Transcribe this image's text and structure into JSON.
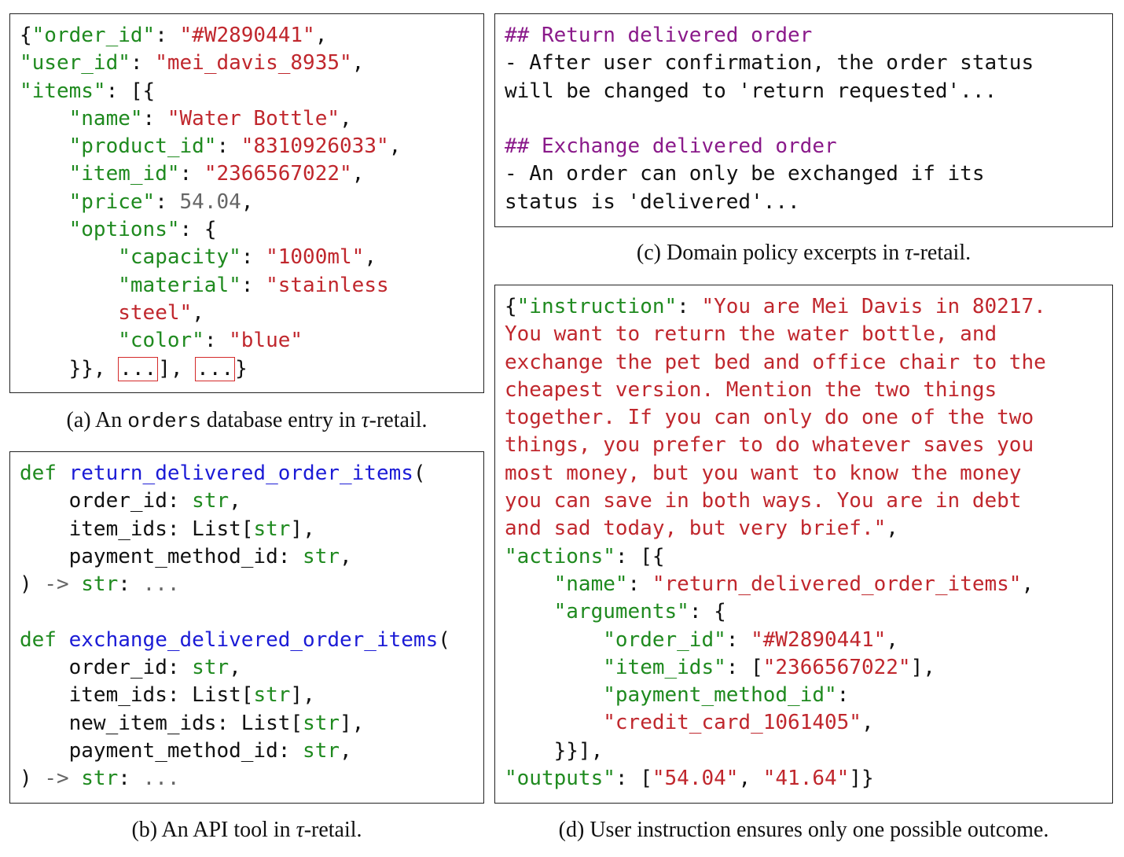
{
  "panel_a": {
    "caption_prefix": "(a) An",
    "caption_code": "orders",
    "caption_middle": "database entry in",
    "caption_tau": "τ",
    "caption_suffix": "-retail.",
    "order_id_key": "\"order_id\"",
    "order_id_val": "\"#W2890441\"",
    "user_id_key": "\"user_id\"",
    "user_id_val": "\"mei_davis_8935\"",
    "items_key": "\"items\"",
    "name_key": "\"name\"",
    "name_val": "\"Water Bottle\"",
    "product_id_key": "\"product_id\"",
    "product_id_val": "\"8310926033\"",
    "item_id_key": "\"item_id\"",
    "item_id_val": "\"2366567022\"",
    "price_key": "\"price\"",
    "price_val": "54.04",
    "options_key": "\"options\"",
    "capacity_key": "\"capacity\"",
    "capacity_val": "\"1000ml\"",
    "material_key": "\"material\"",
    "material_val_1": "\"stainless",
    "material_val_2": "steel\"",
    "color_key": "\"color\"",
    "color_val": "\"blue\"",
    "ellipsis": "..."
  },
  "panel_b": {
    "caption_prefix": "(b) An API tool in",
    "caption_tau": "τ",
    "caption_suffix": "-retail.",
    "def_kw": "def",
    "func1": "return_delivered_order_items",
    "func2": "exchange_delivered_order_items",
    "param_order_id": "order_id",
    "param_item_ids": "item_ids",
    "param_new_item_ids": "new_item_ids",
    "param_payment": "payment_method_id",
    "type_str": "str",
    "type_list": "List",
    "arrow": "->",
    "ellipsis": "..."
  },
  "panel_c": {
    "caption_prefix": "(c) Domain policy excerpts in",
    "caption_tau": "τ",
    "caption_suffix": "-retail.",
    "heading1": "## Return delivered order",
    "line1a": "- After user confirmation, the order status",
    "line1b": "will be changed to 'return requested'...",
    "heading2": "## Exchange delivered order",
    "line2a": "- An order can only be exchanged if its",
    "line2b": "status is 'delivered'..."
  },
  "panel_d": {
    "caption": "(d) User instruction ensures only one possible outcome.",
    "instruction_key": "\"instruction\"",
    "instr_1": "\"You are Mei Davis in 80217.",
    "instr_2": "You want to return the water bottle, and",
    "instr_3": "exchange the pet bed and office chair to the",
    "instr_4": "cheapest version. Mention the two things",
    "instr_5": "together. If you can only do one of the two",
    "instr_6": "things, you prefer to do whatever saves you",
    "instr_7": "most money, but you want to know the money",
    "instr_8": "you can save in both ways. You are in debt",
    "instr_9": "and sad today, but very brief.\"",
    "actions_key": "\"actions\"",
    "name_key": "\"name\"",
    "name_val": "\"return_delivered_order_items\"",
    "arguments_key": "\"arguments\"",
    "order_id_key": "\"order_id\"",
    "order_id_val": "\"#W2890441\"",
    "item_ids_key": "\"item_ids\"",
    "item_ids_val": "\"2366567022\"",
    "payment_key": "\"payment_method_id\"",
    "payment_val": "\"credit_card_1061405\"",
    "outputs_key": "\"outputs\"",
    "output_1": "\"54.04\"",
    "output_2": "\"41.64\""
  }
}
